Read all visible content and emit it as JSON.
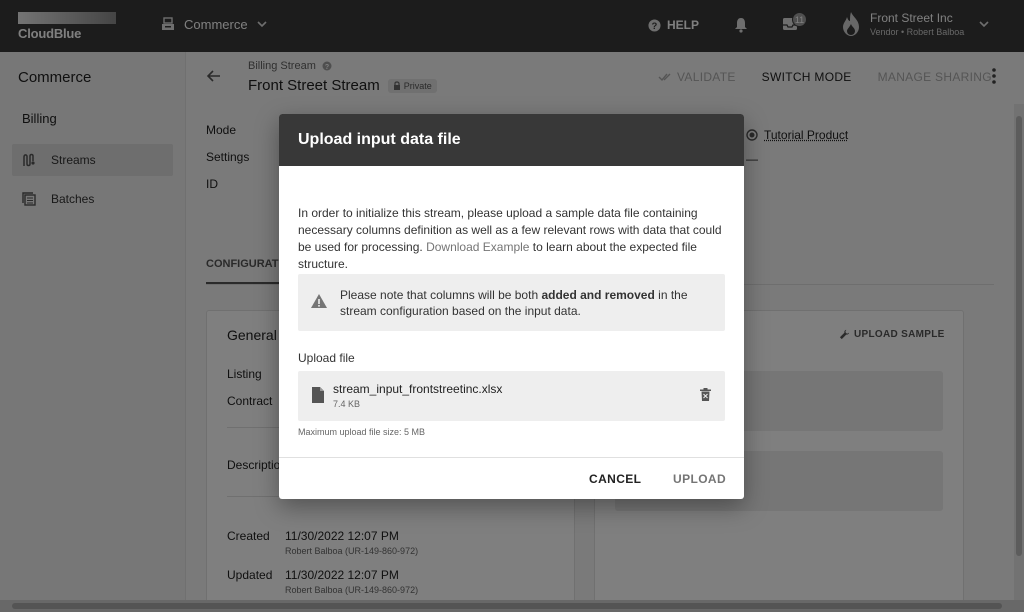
{
  "topbar": {
    "logo": "CloudBlue",
    "module": "Commerce",
    "help": "HELP",
    "inbox_count": "11",
    "account_name": "Front Street Inc",
    "account_sub": "Vendor • Robert Balboa"
  },
  "sidebar": {
    "title": "Commerce",
    "section": "Billing",
    "items": [
      {
        "label": "Streams"
      },
      {
        "label": "Batches"
      }
    ]
  },
  "header": {
    "breadcrumb": "Billing Stream",
    "title": "Front Street Stream",
    "private_chip": "Private",
    "validate": "VALIDATE",
    "switch_mode": "SWITCH MODE",
    "manage_sharing": "MANAGE SHARING"
  },
  "meta": {
    "mode_label": "Mode",
    "settings_label": "Settings",
    "id_label": "ID",
    "product": "Tutorial Product",
    "dash": "—"
  },
  "tabs": {
    "configuration": "CONFIGURATI"
  },
  "general_card": {
    "title": "General",
    "listing_label": "Listing",
    "contract_label": "Contract",
    "description_label": "Descriptio",
    "created_label": "Created",
    "created_value": "11/30/2022 12:07 PM",
    "created_by": "Robert Balboa (UR-149-860-972)",
    "updated_label": "Updated",
    "updated_value": "11/30/2022 12:07 PM",
    "updated_by": "Robert Balboa (UR-149-860-972)"
  },
  "sample_card": {
    "upload_sample": "UPLOAD SAMPLE"
  },
  "modal": {
    "title": "Upload input data file",
    "desc_before": "In order to initialize this stream, please upload a sample data file containing necessary columns definition as well as a few relevant rows with data that could be used for processing. ",
    "desc_link": "Download Example",
    "desc_after": " to learn about the expected file structure.",
    "warn_before": "Please note that columns will be both ",
    "warn_bold": "added and removed",
    "warn_after": " in the stream configuration based on the input data.",
    "upload_label": "Upload file",
    "file_name": "stream_input_frontstreetinc.xlsx",
    "file_size": "7.4 KB",
    "max_hint": "Maximum upload file size: 5 MB",
    "cancel": "CANCEL",
    "upload": "UPLOAD"
  }
}
